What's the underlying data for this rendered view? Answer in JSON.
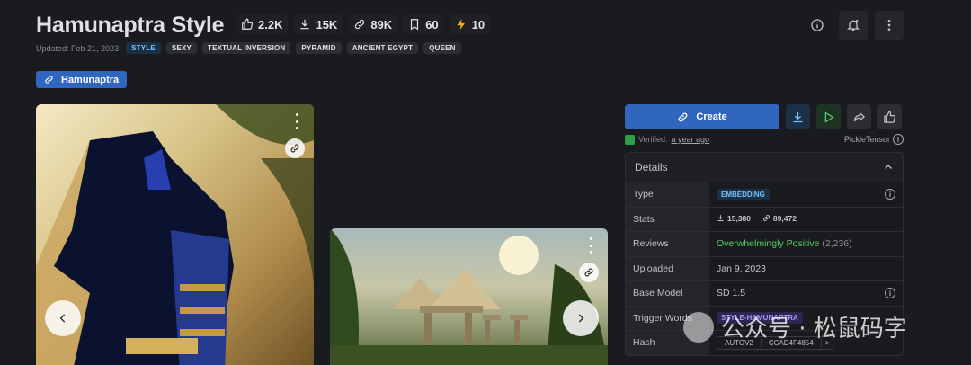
{
  "model": {
    "title": "Hamunaptra Style",
    "stats": {
      "likes": "2.2K",
      "downloads": "15K",
      "links": "89K",
      "saves": "60",
      "buzz": "10"
    },
    "updated": "Updated: Feb 21, 2023",
    "tags": [
      "STYLE",
      "SEXY",
      "TEXTUAL INVERSION",
      "PYRAMID",
      "ANCIENT EGYPT",
      "QUEEN"
    ],
    "collection": "Hamunaptra"
  },
  "actions": {
    "create_label": "Create",
    "verified_label": "Verified:",
    "verified_time": "a year ago",
    "author": "PickleTensor"
  },
  "details": {
    "heading": "Details",
    "type_label": "Type",
    "type_value": "EMBEDDING",
    "stats_label": "Stats",
    "stats_downloads": "15,380",
    "stats_links": "89,472",
    "reviews_label": "Reviews",
    "reviews_value": "Overwhelmingly Positive",
    "reviews_count": "(2,236)",
    "uploaded_label": "Uploaded",
    "uploaded_value": "Jan 9, 2023",
    "base_label": "Base Model",
    "base_value": "SD 1.5",
    "trigger_label": "Trigger Words",
    "trigger_value": "STYLE-HAMUNAPTRA",
    "hash_label": "Hash",
    "hash_type": "AUTOV2",
    "hash_value": "CCAD4F4854",
    "hash_more": ">"
  },
  "watermark": "公众号 · 松鼠码字",
  "colors": {
    "accent": "#3066be",
    "background": "#1a1b1e",
    "positive": "#51cf66"
  }
}
